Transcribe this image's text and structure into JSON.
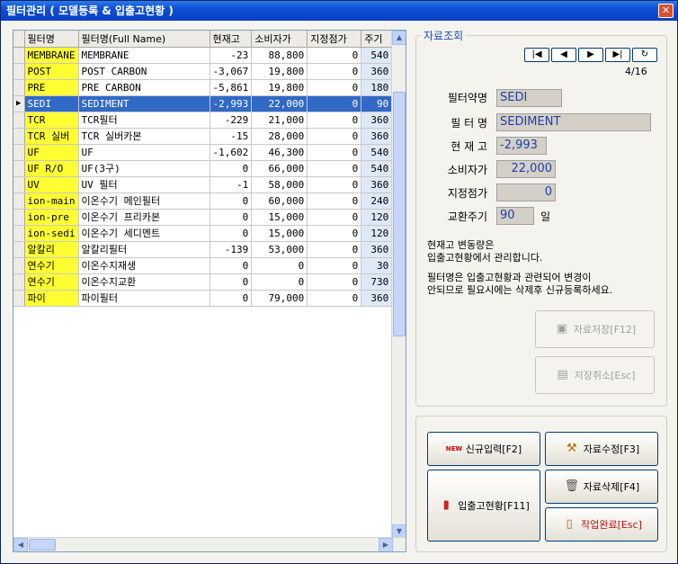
{
  "window": {
    "title": "필터관리 ( 모델등록 & 입출고현황 )",
    "close": "✕"
  },
  "grid": {
    "headers": [
      "필터명",
      "필터명(Full Name)",
      "현재고",
      "소비자가",
      "지정점가",
      "주기"
    ],
    "rows": [
      [
        "MEMBRANE",
        "MEMBRANE",
        "-23",
        "88,800",
        "0",
        "540"
      ],
      [
        "POST",
        "POST CARBON",
        "-3,067",
        "19,800",
        "0",
        "360"
      ],
      [
        "PRE",
        "PRE CARBON",
        "-5,861",
        "19,800",
        "0",
        "180"
      ],
      [
        "SEDI",
        "SEDIMENT",
        "-2,993",
        "22,000",
        "0",
        "90"
      ],
      [
        "TCR",
        "TCR필터",
        "-229",
        "21,000",
        "0",
        "360"
      ],
      [
        "TCR 실버",
        "TCR 실버카본",
        "-15",
        "28,000",
        "0",
        "360"
      ],
      [
        "UF",
        "UF",
        "-1,602",
        "46,300",
        "0",
        "540"
      ],
      [
        "UF R/O",
        "UF(3구)",
        "0",
        "66,000",
        "0",
        "540"
      ],
      [
        "UV",
        "UV 필터",
        "-1",
        "58,000",
        "0",
        "360"
      ],
      [
        "ion-main",
        "이온수기 메인필터",
        "0",
        "60,000",
        "0",
        "240"
      ],
      [
        "ion-pre",
        "이온수기 프리카본",
        "0",
        "15,000",
        "0",
        "120"
      ],
      [
        "ion-sedi",
        "이온수기 세디멘트",
        "0",
        "15,000",
        "0",
        "120"
      ],
      [
        "알칼리",
        "알칼리필터",
        "-139",
        "53,000",
        "0",
        "360"
      ],
      [
        "연수기",
        "이온수지재생",
        "0",
        "0",
        "0",
        "30"
      ],
      [
        "연수기",
        "이온수지교환",
        "0",
        "0",
        "0",
        "730"
      ],
      [
        "파이",
        "파이필터",
        "0",
        "79,000",
        "0",
        "360"
      ]
    ],
    "selected_row_marker": "▶"
  },
  "detail": {
    "section_title": "자료조회",
    "pager": "4/16",
    "nav_icons": [
      "first-icon",
      "prev-icon",
      "next-icon",
      "last-icon",
      "refresh-icon"
    ],
    "nav_glyphs": [
      "|◀",
      "◀",
      "▶",
      "▶|",
      "↻"
    ],
    "fields": {
      "abbr_label": "필터약명",
      "abbr_value": "SEDI",
      "name_label": "필 터 명",
      "name_value": "SEDIMENT",
      "stock_label": "현 재 고",
      "stock_value": "-2,993",
      "price_label": "소비자가",
      "price_value": "22,000",
      "dealer_label": "지정점가",
      "dealer_value": "0",
      "cycle_label": "교환주기",
      "cycle_value": "90",
      "cycle_unit": "일"
    },
    "note1_line1": "현재고 변동량은",
    "note1_line2": "입출고현황에서 관리합니다.",
    "note2_line1": "필터명은 입출고현황과 관련되어 변경이",
    "note2_line2": "안되므로 필요시에는 삭제후 신규등록하세요.",
    "save_label": "자료저장[F12]",
    "cancel_label": "저장취소[Esc]"
  },
  "actions": {
    "new_label": "신규입력[F2]",
    "edit_label": "자료수정[F3]",
    "inout_label": "입출고현황[F11]",
    "delete_label": "자료삭제[F4]",
    "done_label": "작업완료[Esc]",
    "new_badge": "NEW"
  }
}
